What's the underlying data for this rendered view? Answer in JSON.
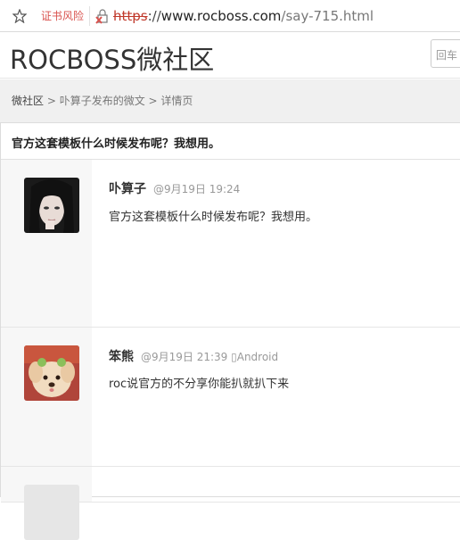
{
  "browser": {
    "cert_warning": "证书风险",
    "url_scheme": "https",
    "url_rest_prefix": "://",
    "url_host": "www.rocboss.com",
    "url_path": "/say-715.html"
  },
  "site": {
    "logo": "ROCBOSS微社区",
    "search_placeholder": "回车"
  },
  "breadcrumb": {
    "home": "微社区",
    "sep1": " > ",
    "user_posts": "卟算子发布的微文",
    "sep2": " > ",
    "current": "详情页"
  },
  "topic": {
    "title": "官方这套模板什么时候发布呢？我想用。"
  },
  "posts": [
    {
      "author": "卟算子",
      "time": "@9月19日 19:24",
      "device": "",
      "content": "官方这套模板什么时候发布呢？我想用。",
      "avatar": "avatar-girl-dark-hair"
    },
    {
      "author": "笨熊",
      "time": "@9月19日 21:39",
      "device": "Android",
      "content": "roc说官方的不分享你能扒就扒下来",
      "avatar": "avatar-puppy"
    }
  ],
  "icons": {
    "bookmark": "star-icon",
    "lock": "broken-lock-icon"
  }
}
